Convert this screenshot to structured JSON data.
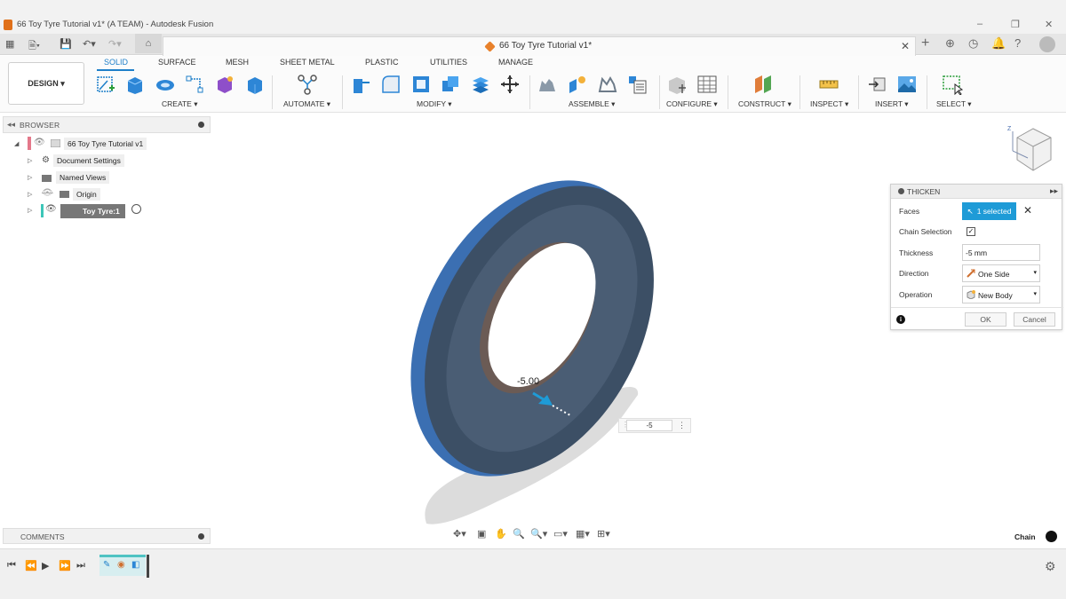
{
  "window": {
    "title": "66 Toy Tyre Tutorial v1* (A TEAM) - Autodesk Fusion",
    "minimize": "–",
    "restore": "❐",
    "close": "✕"
  },
  "document_tab": {
    "title": "66 Toy Tyre Tutorial v1*",
    "close": "✕"
  },
  "toolbar": {
    "workspace": "DESIGN ▾",
    "tabs": [
      "SOLID",
      "SURFACE",
      "MESH",
      "SHEET METAL",
      "PLASTIC",
      "UTILITIES",
      "MANAGE"
    ],
    "groups": [
      "CREATE ▾",
      "AUTOMATE ▾",
      "MODIFY ▾",
      "ASSEMBLE ▾",
      "CONFIGURE ▾",
      "CONSTRUCT ▾",
      "INSPECT ▾",
      "INSERT ▾",
      "SELECT ▾"
    ]
  },
  "browser": {
    "title": "BROWSER",
    "nodes": [
      "66 Toy Tyre Tutorial v1",
      "Document Settings",
      "Named Views",
      "Origin",
      "Toy Tyre:1"
    ]
  },
  "comments": {
    "title": "COMMENTS"
  },
  "thicken": {
    "title": "THICKEN",
    "faces_label": "Faces",
    "faces_value": "1 selected",
    "chain_label": "Chain Selection",
    "chain_checked": "✓",
    "thickness_label": "Thickness",
    "thickness_value": "-5 mm",
    "direction_label": "Direction",
    "direction_value": "One Side",
    "operation_label": "Operation",
    "operation_value": "New Body",
    "ok": "OK",
    "cancel": "Cancel",
    "info": "i"
  },
  "viewport": {
    "dimension_label": "-5.00",
    "value_box": "-5",
    "chain_text": "Chain"
  },
  "colors": {
    "accent": "#1e7fc9",
    "selected_button": "#1e9bd7",
    "tyre_face": "#3c4f65",
    "tyre_edge": "#3b6fb2"
  }
}
